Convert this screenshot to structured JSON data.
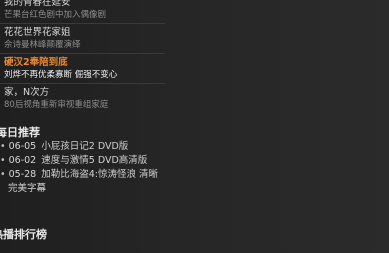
{
  "list": [
    {
      "title": "我的青春在延安",
      "subtitle": "芒果台红色剧中加入偶像剧",
      "active": false
    },
    {
      "title": "花花世界花家姐",
      "subtitle": "佘诗曼林峰颠覆演绎",
      "active": false
    },
    {
      "title": "硬汉2奉陪到底",
      "subtitle": "刘烨不再优柔寡断 倔强不变心",
      "active": true
    },
    {
      "title": "家，N次方",
      "subtitle": "80后视角重新审视重组家庭",
      "active": false
    }
  ],
  "daily": {
    "heading": "每日推荐",
    "items": [
      {
        "date": "06-05",
        "text": "小屁孩日记2 DVD版"
      },
      {
        "date": "06-02",
        "text": "速度与激情5 DVD高清版"
      },
      {
        "date": "05-28",
        "text": "加勒比海盗4:惊涛怪浪 清晰",
        "continuation": "完美字幕"
      }
    ]
  },
  "ranking": {
    "heading": "热播排行榜"
  },
  "colors": {
    "accent": "#e88a2a",
    "background": "#232323"
  }
}
